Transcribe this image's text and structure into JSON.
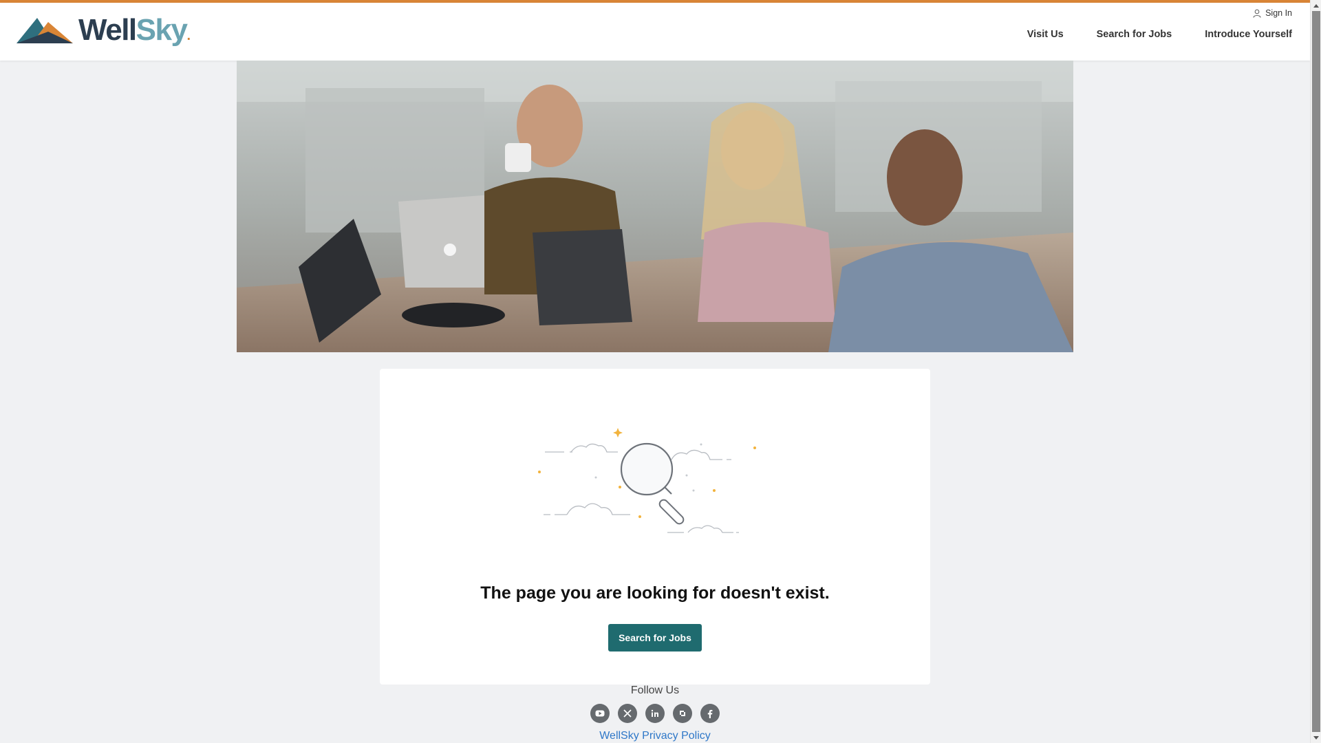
{
  "header": {
    "logo_text_well": "Well",
    "logo_text_sky": "Sky",
    "signin_label": "Sign In",
    "nav": [
      {
        "label": "Visit Us"
      },
      {
        "label": "Search for Jobs"
      },
      {
        "label": "Introduce Yourself"
      }
    ]
  },
  "main": {
    "error_message": "The page you are looking for doesn't exist.",
    "search_button_label": "Search for Jobs"
  },
  "footer": {
    "follow_label": "Follow Us",
    "social_icons": [
      "youtube-icon",
      "x-icon",
      "linkedin-icon",
      "glassdoor-icon",
      "facebook-icon"
    ],
    "privacy_label": "WellSky Privacy Policy"
  },
  "colors": {
    "accent": "#d98536",
    "brand_teal": "#1f6b6f",
    "link": "#2e77c8",
    "background": "#f0f1f3"
  }
}
